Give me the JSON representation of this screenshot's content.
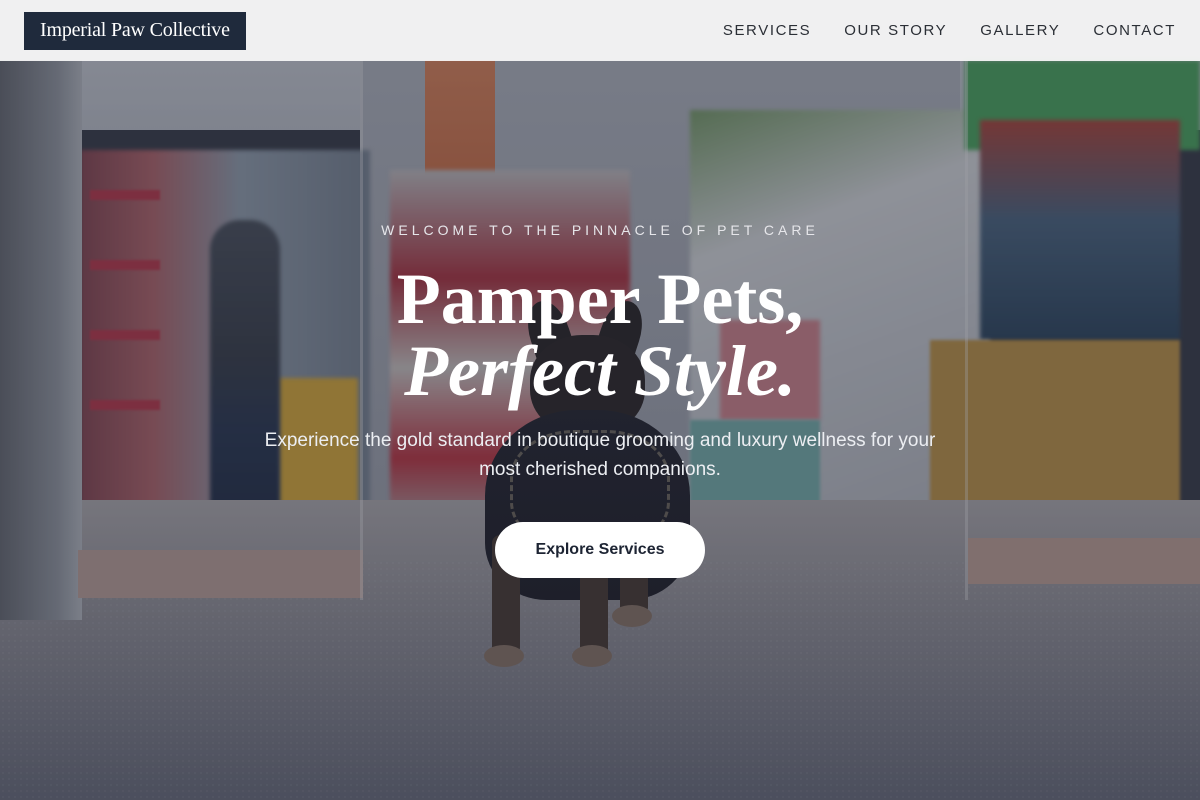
{
  "brand": {
    "name": "Imperial Paw Collective"
  },
  "nav": {
    "links": [
      {
        "label": "SERVICES"
      },
      {
        "label": "OUR STORY"
      },
      {
        "label": "GALLERY"
      },
      {
        "label": "CONTACT"
      }
    ]
  },
  "hero": {
    "eyebrow": "WELCOME TO THE PINNACLE OF PET CARE",
    "headline_line1": "Pamper Pets,",
    "headline_line2": "Perfect Style.",
    "subtext": "Experience the gold standard in boutique grooming and luxury wellness for your most cherished companions.",
    "cta_label": "Explore Services"
  },
  "colors": {
    "brand_bg": "#1f2a3c",
    "navbar_bg": "#f6f6f7",
    "cta_bg": "#ffffff",
    "cta_text": "#1d2433",
    "overlay": "#1c202e"
  }
}
